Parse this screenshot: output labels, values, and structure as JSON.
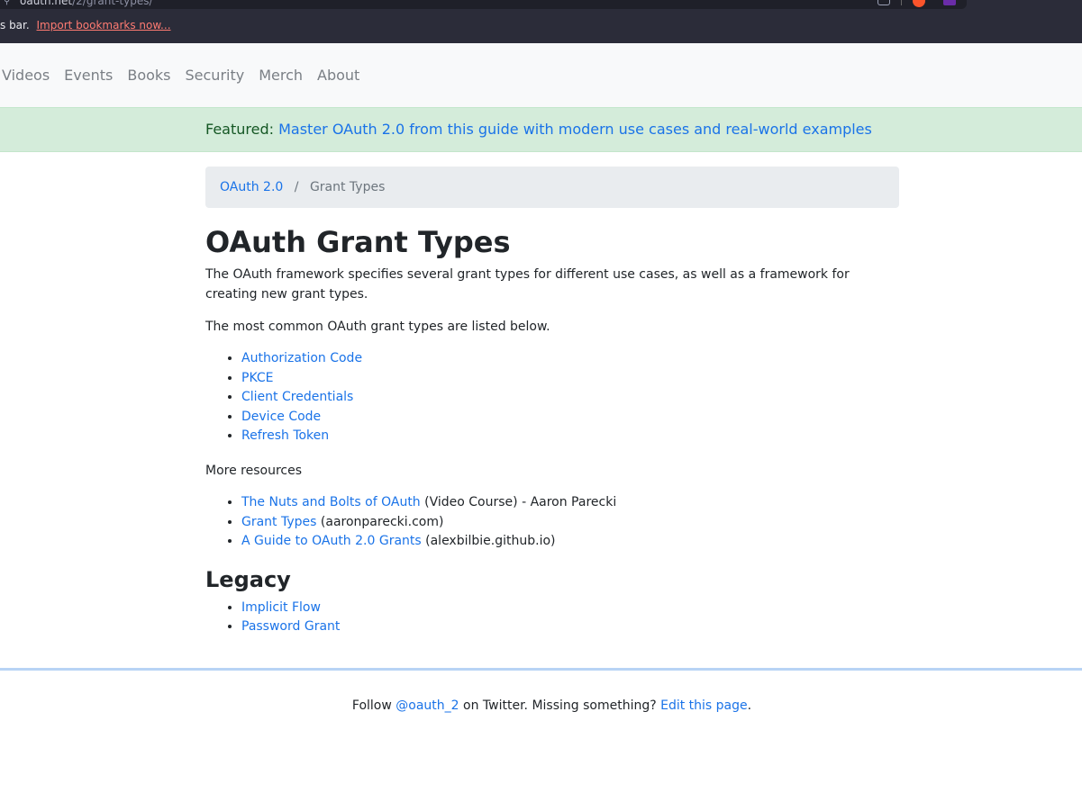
{
  "browser": {
    "url_domain": "oauth.net",
    "url_path": "/2/grant-types/",
    "bookmarks_prefix": "s bar.",
    "bookmarks_import_link": "Import bookmarks now..."
  },
  "nav": {
    "items": [
      "Videos",
      "Events",
      "Books",
      "Security",
      "Merch",
      "About"
    ]
  },
  "banner": {
    "prefix": "Featured:",
    "link": "Master OAuth 2.0 from this guide with modern use cases and real-world examples"
  },
  "breadcrumb": {
    "parent": "OAuth 2.0",
    "separator": "/",
    "current": "Grant Types"
  },
  "main": {
    "title": "OAuth Grant Types",
    "intro": "The OAuth framework specifies several grant types for different use cases, as well as a framework for creating new grant types.",
    "common_intro": "The most common OAuth grant types are listed below.",
    "grant_types": [
      "Authorization Code",
      "PKCE",
      "Client Credentials",
      "Device Code",
      "Refresh Token"
    ],
    "more_resources_label": "More resources",
    "resources": [
      {
        "link": "The Nuts and Bolts of OAuth",
        "suffix": " (Video Course) - Aaron Parecki"
      },
      {
        "link": "Grant Types",
        "suffix": " (aaronparecki.com)"
      },
      {
        "link": "A Guide to OAuth 2.0 Grants",
        "suffix": " (alexbilbie.github.io)"
      }
    ],
    "legacy_title": "Legacy",
    "legacy_items": [
      "Implicit Flow",
      "Password Grant"
    ]
  },
  "footer": {
    "follow": "Follow ",
    "twitter_handle": "@oauth_2",
    "on_twitter": " on Twitter. Missing something? ",
    "edit_link": "Edit this page",
    "period": "."
  },
  "colors": {
    "link": "#1a73e8",
    "banner_bg": "#d4ecda",
    "breadcrumb_bg": "#e9ecef",
    "browser_bg": "#2b2c39"
  }
}
